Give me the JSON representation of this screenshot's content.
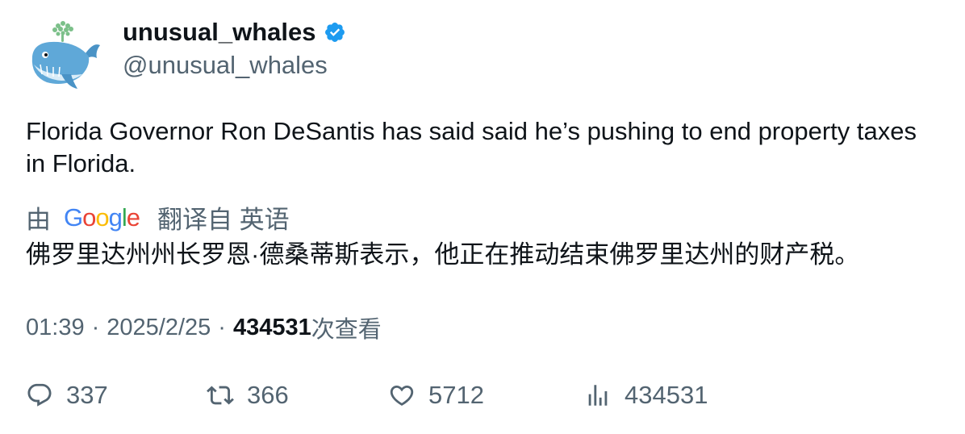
{
  "tweet": {
    "author": {
      "display_name": "unusual_whales",
      "handle": "@unusual_whales",
      "verified": true,
      "verified_color": "#1d9bf0"
    },
    "text": "Florida Governor Ron DeSantis has said said he’s pushing to end property taxes in Florida.",
    "translation": {
      "by_label": "由",
      "provider_logo": "Google",
      "from_label": "翻译自 英语",
      "text": "佛罗里达州州长罗恩·德桑蒂斯表示，他正在推动结束佛罗里达州的财产税。"
    },
    "meta": {
      "time": "01:39",
      "date": "2025/2/25",
      "separator": "·",
      "views_count": "434531",
      "views_label": "次查看"
    },
    "actions": {
      "replies": "337",
      "retweets": "366",
      "likes": "5712",
      "views": "434531"
    }
  },
  "icons": {
    "avatar": "whale-avatar-icon",
    "verified": "verified-badge-icon",
    "reply": "reply-icon",
    "retweet": "retweet-icon",
    "like": "heart-icon",
    "analytics": "analytics-icon"
  },
  "colors": {
    "text_primary": "#0f1419",
    "text_secondary": "#536471",
    "whale_blue": "#5fa8d8",
    "whale_spout": "#7cc08a"
  }
}
